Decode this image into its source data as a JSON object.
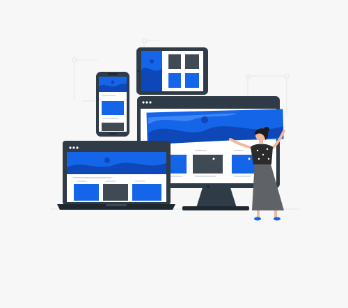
{
  "illustration": {
    "subject": "responsive-web-design",
    "colors": {
      "accent": "#1565e8",
      "accent_light": "#3f86f5",
      "accent_dark": "#0d47b8",
      "device_frame": "#2f3b46",
      "device_frame_dark": "#1f2830",
      "card_dark": "#3f4a55",
      "screen_bg": "#ffffff",
      "text_line": "#c7cdd3",
      "background": "#f7f7f7",
      "guide_line": "#dfe2e5",
      "skirt": "#5f6368",
      "top": "#2b2b2b",
      "skin": "#f2b8a0",
      "hair": "#1c1c1c"
    },
    "devices": [
      "desktop-monitor",
      "laptop",
      "tablet",
      "phone"
    ],
    "figure": "woman-holding-banner"
  }
}
